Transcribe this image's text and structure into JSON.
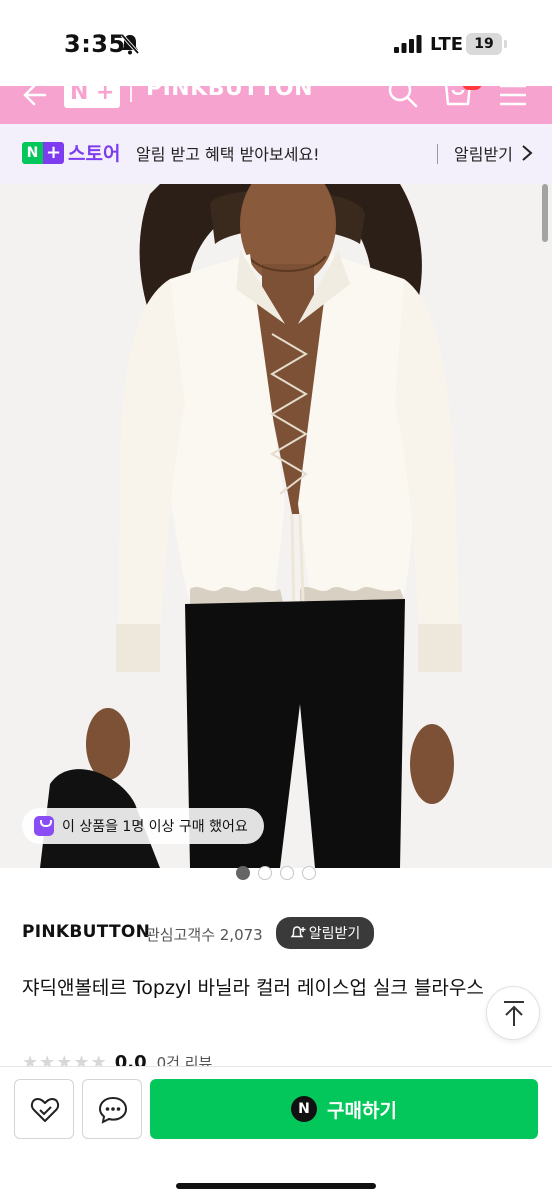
{
  "status_bar": {
    "time": "3:35",
    "network": "LTE",
    "battery": "19",
    "icons": [
      "bell-slash-icon",
      "signal-icon"
    ]
  },
  "header": {
    "logo_left": "N",
    "logo_right": "+",
    "brand": "PINKBUTTON",
    "icons": [
      "back-arrow-icon",
      "search-icon",
      "cart-icon",
      "hamburger-menu-icon"
    ],
    "color": "#f7a3cf"
  },
  "notice": {
    "logo_n": "N",
    "logo_plus": "+",
    "store_label": "스토어",
    "message": "알림 받고 혜택 받아보세요!",
    "action_label": "알림받기"
  },
  "image": {
    "purchase_chip": "이 상품을 1명 이상 구매 했어요",
    "pages": 4,
    "active_page": 1
  },
  "product": {
    "brand": "PINKBUTTON",
    "interest": "관심고객수 2,073",
    "alarm_button": "알림받기",
    "title": "쟈딕앤볼테르 Topzyl 바닐라 컬러 레이스업 실크 블라우스",
    "rating": "0.0",
    "reviews": "0건 리뷰",
    "stars_filled": 0
  },
  "bottom_bar": {
    "buy_button": "구매하기",
    "buy_logo": "N",
    "buy_color": "#03c75a",
    "icons": [
      "wishlist-heart-icon",
      "chat-bubble-icon"
    ]
  }
}
